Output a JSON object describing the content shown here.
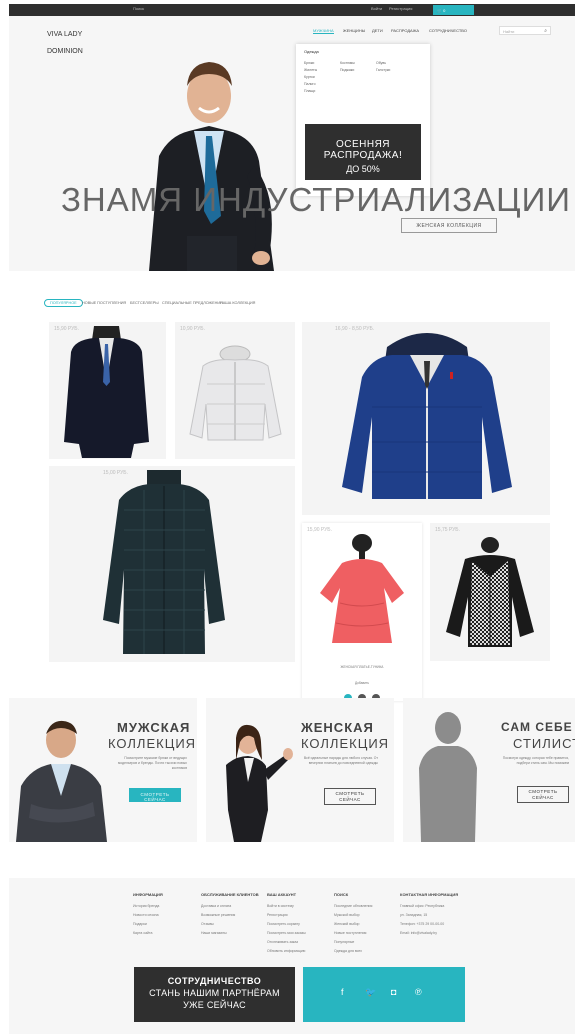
{
  "topbar": {
    "left_text": "Поиск",
    "link1": "Войти",
    "link2": "Регистрация",
    "cart": "0"
  },
  "header": {
    "logo_line1": "VIVA LADY",
    "logo_line2": "DOMINION",
    "nav": [
      "МУЖЧИНА",
      "ЖЕНЩИНЫ",
      "ДЕТИ",
      "РАСПРОДАЖА",
      "СОТРУДНИЧЕСТВО"
    ],
    "search_placeholder": "Найти"
  },
  "dropdown": {
    "header": "Одежда",
    "col1": [
      "Брюки",
      "Жилеты",
      "Куртки",
      "Пальто",
      "Плащи"
    ],
    "col2": [
      "Костюмы",
      "Пиджаки"
    ],
    "col3": [
      "Обувь",
      "Галстуки"
    ],
    "promo_line1": "ОСЕННЯЯ РАСПРОДАЖА!",
    "promo_line2": "ДО 50%"
  },
  "hero": {
    "headline": "ЗНАМЯ ИНДУСТРИАЛИЗАЦИИ",
    "button": "ЖЕНСКАЯ КОЛЛЕКЦИЯ"
  },
  "tabs": [
    "ПОПУЛЯРНОЕ",
    "НОВЫЕ ПОСТУПЛЕНИЯ",
    "БЕСТСЕЛЛЕРЫ",
    "СПЕЦИАЛЬНЫЕ ПРЕДЛОЖЕНИЯ",
    "НАША КОЛЛЕКЦИЯ"
  ],
  "products": {
    "p1_price": "15,90 РУБ.",
    "p2_price": "10,90 РУБ.",
    "p3_price": "16,90 - 8,50 РУБ.",
    "p4_price": "15,00 РУБ.",
    "p5_price": "15,90 РУБ.",
    "p6_price": "15,75 РУБ.",
    "p5_name": "ЖЕНСКАЯ ПЛАТЬЕ-ТУНИКА",
    "p5_extra": "Добавить"
  },
  "collections": {
    "men_t1": "МУЖСКАЯ",
    "men_t2": "КОЛЛЕКЦИЯ",
    "men_desc": "Посмотрите мужские брюки от ведущих модельеров и бренды. Почти тысячи новых костюмов",
    "men_btn": "СМОТРЕТЬ СЕЙЧАС",
    "women_t1": "ЖЕНСКАЯ",
    "women_t2": "КОЛЛЕКЦИЯ",
    "women_desc": "Всё идеальные наряды для любого случая. От вечерних платьев до повседневной одежды",
    "women_btn1": "СМОТРЕТЬ",
    "women_btn2": "СЕЙЧАС",
    "stylist_t1": "САМ СЕБЕ",
    "stylist_t2": "СТИЛИСТ",
    "stylist_desc": "Посмотри одежду, которая тебе нравится, подбери стиль сам. Мы поможем",
    "stylist_btn1": "СМОТРЕТЬ",
    "stylist_btn2": "СЕЙЧАС"
  },
  "footer": {
    "cols": [
      {
        "title": "ИНФОРМАЦИЯ",
        "items": [
          "История бренда",
          "Новости сезона",
          "Подарки",
          "Карта сайта"
        ]
      },
      {
        "title": "ОБСЛУЖИВАНИЕ КЛИЕНТОВ",
        "items": [
          "Доставка и оплата",
          "Возможные решения",
          "Отзывы",
          "Наши магазины"
        ]
      },
      {
        "title": "ВАШ АККАУНТ",
        "items": [
          "Войти в систему",
          "Регистрация",
          "Посмотреть корзину",
          "Посмотреть мои заказы",
          "Отслеживать заказ",
          "Обновить информацию"
        ]
      },
      {
        "title": "ПОИСК",
        "items": [
          "Последние обновления",
          "Мужской выбор",
          "Женский выбор",
          "Новые поступления",
          "Популярные",
          "Одежда для всех"
        ]
      },
      {
        "title": "КОНТАКТНАЯ ИНФОРМАЦИЯ",
        "items": [
          "Главный офис: Республика",
          "ул. Западная, 15",
          "Телефон: +375 29 00-00-00",
          "Email: info@vivalady.by"
        ]
      }
    ],
    "partner_line1": "СОТРУДНИЧЕСТВО",
    "partner_line2": "СТАНЬ НАШИМ ПАРТНЁРАМ",
    "partner_line3": "УЖЕ СЕЙЧАС"
  },
  "colors": {
    "accent": "#28b5c0",
    "dark": "#2f2f2f"
  }
}
